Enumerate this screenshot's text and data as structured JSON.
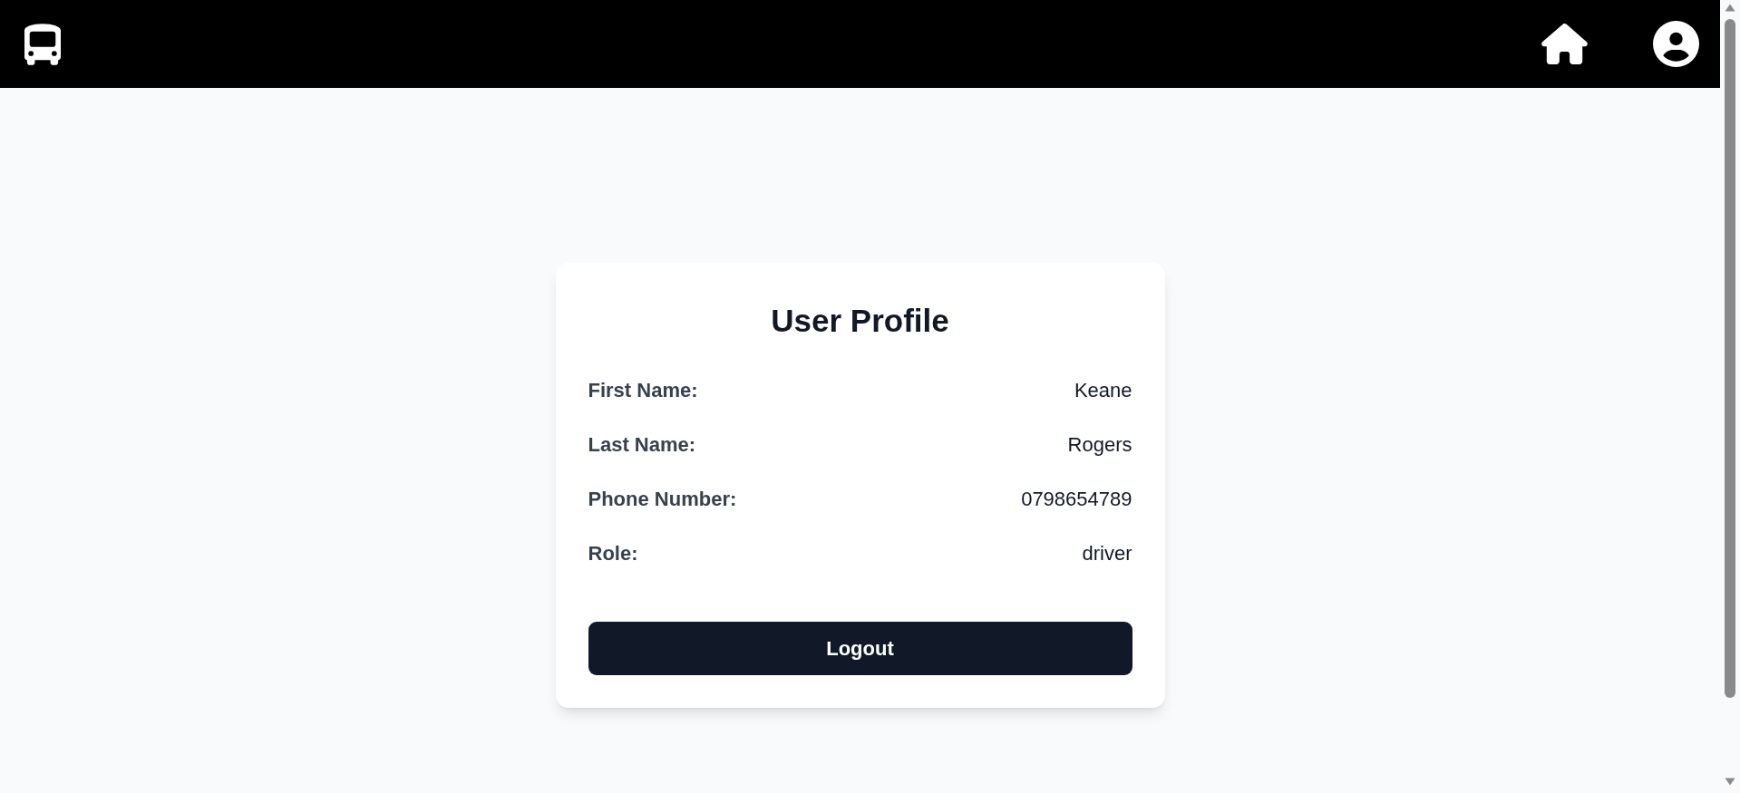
{
  "profile": {
    "title": "User Profile",
    "fields": [
      {
        "label": "First Name:",
        "value": "Keane"
      },
      {
        "label": "Last Name:",
        "value": "Rogers"
      },
      {
        "label": "Phone Number:",
        "value": "0798654789"
      },
      {
        "label": "Role:",
        "value": "driver"
      }
    ],
    "logout_button": "Logout"
  }
}
